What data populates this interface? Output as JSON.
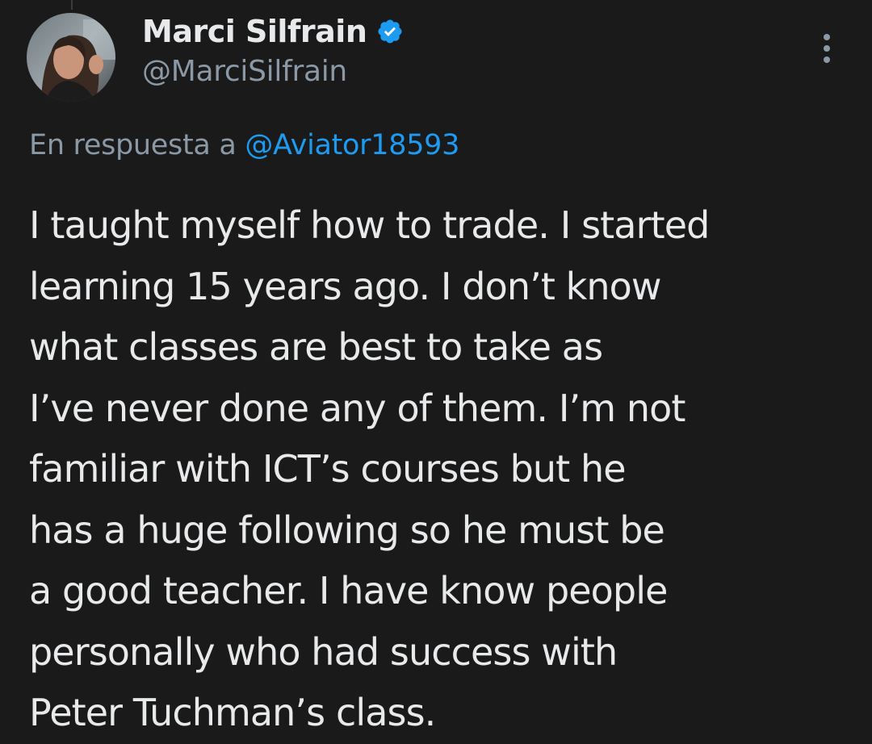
{
  "tweet": {
    "author": {
      "display_name": "Marci Silfrain",
      "handle": "@MarciSilfrain",
      "verified": true
    },
    "reply_to": {
      "prefix": "En respuesta a",
      "mention": "@Aviator18593"
    },
    "text_lines": [
      "I taught myself how to trade. I started",
      "learning 15 years ago. I don’t know",
      "what classes are best to take as",
      "I’ve never done any of them. I’m not",
      "familiar with ICT’s courses but he",
      "has a huge following so he must be",
      "a good teacher. I have know people",
      "personally who had success with",
      "Peter Tuchman’s class."
    ]
  },
  "icons": {
    "verified": "verified-badge-icon",
    "more": "more-options-icon"
  },
  "colors": {
    "background": "#1a1a1a",
    "text_primary": "#e7e9ea",
    "text_secondary": "#8b98a5",
    "accent": "#1d9bf0"
  }
}
